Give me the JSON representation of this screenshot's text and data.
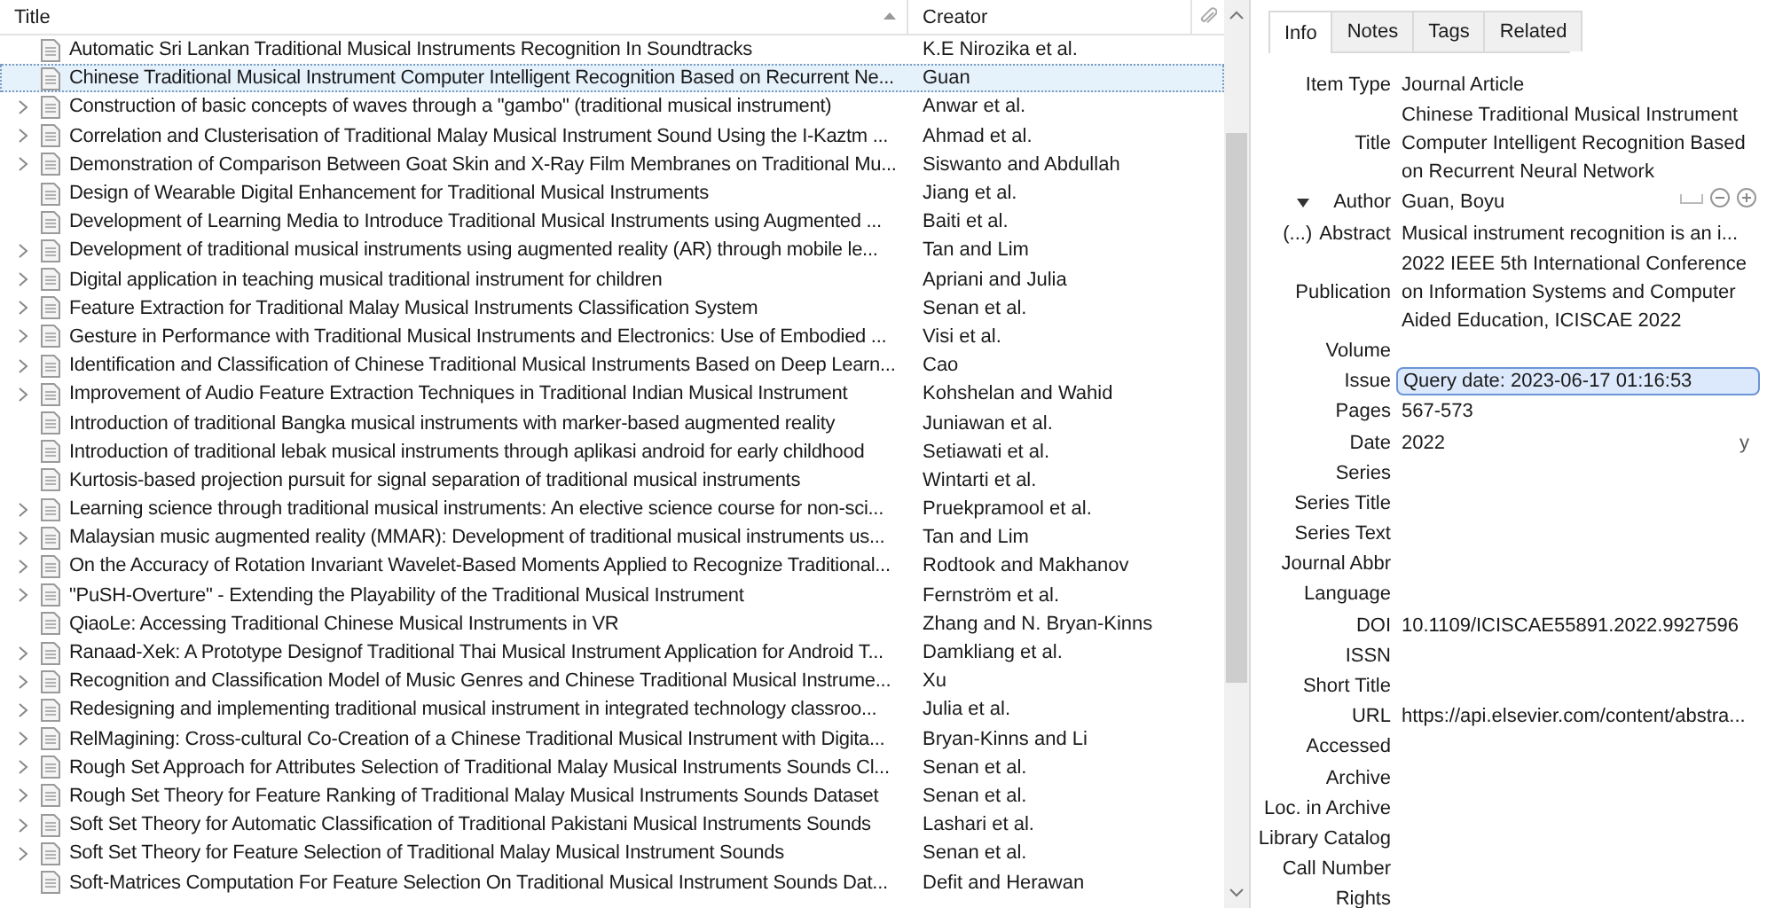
{
  "columns": [
    {
      "label": "Title",
      "sorted": true
    },
    {
      "label": "Creator",
      "sorted": false
    }
  ],
  "items": [
    {
      "title": "Automatic Sri Lankan Traditional Musical Instruments Recognition In Soundtracks",
      "creator": "K.E Nirozika et al.",
      "expandable": false,
      "selected": false
    },
    {
      "title": "Chinese Traditional Musical Instrument Computer Intelligent Recognition Based on Recurrent Ne...",
      "creator": "Guan",
      "expandable": false,
      "selected": true
    },
    {
      "title": "Construction of basic concepts of waves through a \"gambo\" (traditional musical instrument)",
      "creator": "Anwar et al.",
      "expandable": true,
      "selected": false
    },
    {
      "title": "Correlation and Clusterisation of Traditional Malay Musical Instrument Sound Using the I-Kaztm ...",
      "creator": "Ahmad et al.",
      "expandable": true,
      "selected": false
    },
    {
      "title": "Demonstration of Comparison Between Goat Skin and X-Ray Film Membranes on Traditional Mu...",
      "creator": "Siswanto and Abdullah",
      "expandable": true,
      "selected": false
    },
    {
      "title": "Design of Wearable Digital Enhancement for Traditional Musical Instruments",
      "creator": "Jiang et al.",
      "expandable": false,
      "selected": false
    },
    {
      "title": "Development of Learning Media to Introduce Traditional Musical Instruments using Augmented ...",
      "creator": "Baiti et al.",
      "expandable": false,
      "selected": false
    },
    {
      "title": "Development of traditional musical instruments using augmented reality (AR) through mobile le...",
      "creator": "Tan and Lim",
      "expandable": true,
      "selected": false
    },
    {
      "title": "Digital application in teaching musical traditional instrument for children",
      "creator": "Apriani and Julia",
      "expandable": true,
      "selected": false
    },
    {
      "title": "Feature Extraction for Traditional Malay Musical Instruments Classification System",
      "creator": "Senan et al.",
      "expandable": true,
      "selected": false
    },
    {
      "title": "Gesture in Performance with Traditional Musical Instruments and Electronics: Use of Embodied ...",
      "creator": "Visi et al.",
      "expandable": true,
      "selected": false
    },
    {
      "title": "Identification and Classification of Chinese Traditional Musical Instruments Based on Deep Learn...",
      "creator": "Cao",
      "expandable": true,
      "selected": false
    },
    {
      "title": "Improvement of Audio Feature Extraction Techniques in Traditional Indian Musical Instrument",
      "creator": "Kohshelan and Wahid",
      "expandable": true,
      "selected": false
    },
    {
      "title": "Introduction of traditional Bangka musical instruments with marker-based augmented reality",
      "creator": "Juniawan et al.",
      "expandable": false,
      "selected": false
    },
    {
      "title": "Introduction of traditional lebak musical instruments through aplikasi android for early childhood",
      "creator": "Setiawati et al.",
      "expandable": false,
      "selected": false
    },
    {
      "title": "Kurtosis-based projection pursuit for signal separation of traditional musical instruments",
      "creator": "Wintarti et al.",
      "expandable": false,
      "selected": false
    },
    {
      "title": "Learning science through traditional musical instruments: An elective science course for non-sci...",
      "creator": "Pruekpramool et al.",
      "expandable": true,
      "selected": false
    },
    {
      "title": "Malaysian music augmented reality (MMAR): Development of traditional musical instruments us...",
      "creator": "Tan and Lim",
      "expandable": true,
      "selected": false
    },
    {
      "title": "On the Accuracy of Rotation Invariant Wavelet-Based Moments Applied to Recognize Traditional...",
      "creator": "Rodtook and Makhanov",
      "expandable": true,
      "selected": false
    },
    {
      "title": "\"PuSH-Overture\" - Extending the Playability of the Traditional Musical Instrument",
      "creator": "Fernström et al.",
      "expandable": true,
      "selected": false
    },
    {
      "title": "QiaoLe: Accessing Traditional Chinese Musical Instruments in VR",
      "creator": "Zhang and N. Bryan-Kinns",
      "expandable": false,
      "selected": false
    },
    {
      "title": "Ranaad-Xek: A Prototype Designof Traditional Thai Musical Instrument Application for Android T...",
      "creator": "Damkliang et al.",
      "expandable": true,
      "selected": false
    },
    {
      "title": "Recognition and Classification Model of Music Genres and Chinese Traditional Musical Instrume...",
      "creator": "Xu",
      "expandable": true,
      "selected": false
    },
    {
      "title": "Redesigning and implementing traditional musical instrument in integrated technology classroo...",
      "creator": "Julia et al.",
      "expandable": true,
      "selected": false
    },
    {
      "title": "RelMagining: Cross-cultural Co-Creation of a Chinese Traditional Musical Instrument with Digita...",
      "creator": "Bryan-Kinns and Li",
      "expandable": true,
      "selected": false
    },
    {
      "title": "Rough Set Approach for Attributes Selection of Traditional Malay Musical Instruments Sounds Cl...",
      "creator": "Senan et al.",
      "expandable": true,
      "selected": false
    },
    {
      "title": "Rough Set Theory for Feature Ranking of Traditional Malay Musical Instruments Sounds Dataset",
      "creator": "Senan et al.",
      "expandable": true,
      "selected": false
    },
    {
      "title": "Soft Set Theory for Automatic Classification of Traditional Pakistani Musical Instruments Sounds",
      "creator": "Lashari et al.",
      "expandable": true,
      "selected": false
    },
    {
      "title": "Soft Set Theory for Feature Selection of Traditional Malay Musical Instrument Sounds",
      "creator": "Senan et al.",
      "expandable": true,
      "selected": false
    },
    {
      "title": "Soft-Matrices Computation For Feature Selection On Traditional Musical Instrument Sounds Dat...",
      "creator": "Defit and Herawan",
      "expandable": false,
      "selected": false
    }
  ],
  "item_pane": {
    "tabs": [
      {
        "label": "Info",
        "selected": true
      },
      {
        "label": "Notes",
        "selected": false
      },
      {
        "label": "Tags",
        "selected": false
      },
      {
        "label": "Related",
        "selected": false
      }
    ],
    "fields": [
      {
        "kind": "plain",
        "label": "Item Type",
        "value": "Journal Article"
      },
      {
        "kind": "plain",
        "label": "Title",
        "value": "Chinese Traditional Musical Instrument Computer Intelligent Recognition Based on Recurrent Neural Network"
      },
      {
        "kind": "author",
        "label": "Author",
        "value": "Guan, Boyu"
      },
      {
        "kind": "abstract",
        "toggle": "(...)",
        "label": "Abstract",
        "value": "Musical instrument recognition is an i..."
      },
      {
        "kind": "plain",
        "label": "Publication",
        "value": "2022 IEEE 5th International Conference on Information Systems and Computer Aided Education, ICISCAE 2022"
      },
      {
        "kind": "plain",
        "label": "Volume"
      },
      {
        "kind": "editing",
        "label": "Issue",
        "value": "Query date: 2023-06-17 01:16:53"
      },
      {
        "kind": "plain",
        "label": "Pages",
        "value": "567-573"
      },
      {
        "kind": "date",
        "label": "Date",
        "value": "2022",
        "suffix": "y"
      },
      {
        "kind": "plain",
        "label": "Series"
      },
      {
        "kind": "plain",
        "label": "Series Title"
      },
      {
        "kind": "plain",
        "label": "Series Text"
      },
      {
        "kind": "plain",
        "label": "Journal Abbr"
      },
      {
        "kind": "plain",
        "label": "Language"
      },
      {
        "kind": "plain",
        "label": "DOI",
        "value": "10.1109/ICISCAE55891.2022.9927596"
      },
      {
        "kind": "plain",
        "label": "ISSN"
      },
      {
        "kind": "plain",
        "label": "Short Title"
      },
      {
        "kind": "plain",
        "label": "URL",
        "value": "https://api.elsevier.com/content/abstra..."
      },
      {
        "kind": "plain",
        "label": "Accessed"
      },
      {
        "kind": "plain",
        "label": "Archive"
      },
      {
        "kind": "plain",
        "label": "Loc. in Archive"
      },
      {
        "kind": "plain",
        "label": "Library Catalog"
      },
      {
        "kind": "plain",
        "label": "Call Number"
      },
      {
        "kind": "plain",
        "label": "Rights"
      }
    ]
  }
}
